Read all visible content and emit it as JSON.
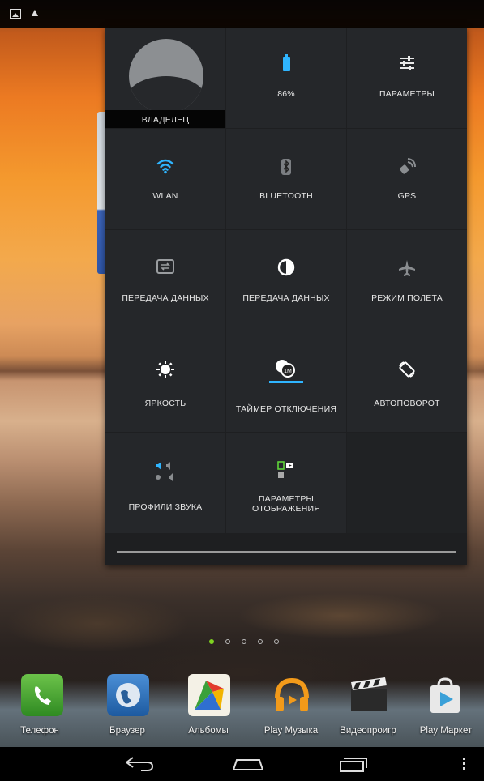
{
  "status_bar": {
    "icons": [
      "gallery-icon",
      "warning-icon"
    ],
    "warning_glyph": "▲"
  },
  "quick_settings": {
    "tiles": [
      {
        "id": "owner",
        "label": "ВЛАДЕЛЕЦ",
        "icon": "avatar"
      },
      {
        "id": "battery",
        "label": "86%",
        "icon": "battery-icon"
      },
      {
        "id": "settings",
        "label": "ПАРАМЕТРЫ",
        "icon": "sliders-icon"
      },
      {
        "id": "wlan",
        "label": "WLAN",
        "icon": "wifi-icon",
        "active_color": "#2fb5ff"
      },
      {
        "id": "bluetooth",
        "label": "BLUETOOTH",
        "icon": "bluetooth-icon"
      },
      {
        "id": "gps",
        "label": "GPS",
        "icon": "gps-icon"
      },
      {
        "id": "data1",
        "label": "ПЕРЕДАЧА ДАННЫХ",
        "icon": "data-transfer-icon"
      },
      {
        "id": "data2",
        "label": "ПЕРЕДАЧА ДАННЫХ",
        "icon": "data-usage-icon"
      },
      {
        "id": "airplane",
        "label": "РЕЖИМ ПОЛЕТА",
        "icon": "airplane-icon"
      },
      {
        "id": "brightness",
        "label": "ЯРКОСТЬ",
        "icon": "brightness-icon"
      },
      {
        "id": "sleep_timer",
        "label": "ТАЙМЕР ОТКЛЮЧЕНИЯ",
        "icon": "timer-icon",
        "timer_value": "1M"
      },
      {
        "id": "autorotate",
        "label": "АВТОПОВОРОТ",
        "icon": "rotate-icon"
      },
      {
        "id": "sound_profiles",
        "label": "ПРОФИЛИ ЗВУКА",
        "icon": "sound-profiles-icon"
      },
      {
        "id": "display_settings",
        "label": "ПАРАМЕТРЫ ОТОБРАЖЕНИЯ",
        "icon": "display-settings-icon"
      }
    ]
  },
  "page_indicator": {
    "count": 5,
    "active": 0,
    "active_color": "#7ed321"
  },
  "dock": {
    "apps": [
      {
        "label": "Телефон",
        "icon": "phone-app-icon",
        "color": "#3a9a2c"
      },
      {
        "label": "Браузер",
        "icon": "browser-app-icon",
        "color": "#2c6bb0"
      },
      {
        "label": "Альбомы",
        "icon": "albums-app-icon",
        "color": "#d9a03a"
      },
      {
        "label": "Play Музыка",
        "icon": "play-music-app-icon",
        "color": "#f29a1a"
      },
      {
        "label": "Видеопроигр",
        "icon": "video-player-app-icon",
        "color": "#333333"
      },
      {
        "label": "Play Маркет",
        "icon": "play-market-app-icon",
        "color": "#e8e8e8"
      }
    ]
  },
  "nav_bar": {
    "buttons": [
      "back-icon",
      "home-icon",
      "recents-icon",
      "menu-icon"
    ]
  }
}
